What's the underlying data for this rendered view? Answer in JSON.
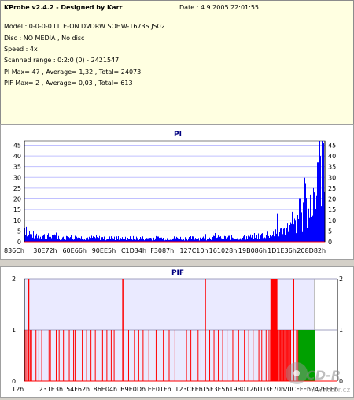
{
  "header": {
    "title": "KProbe v2.4.2 - Designed by Karr",
    "date": "Date : 4.9.2005 22:01:55",
    "model": "Model : 0-0-0-0 LITE-ON DVDRW SOHW-1673S JS02",
    "disc": "Disc : NO MEDIA , No disc",
    "speed": "Speed : 4x",
    "scanned": "Scanned range : 0:2:0 (0) - 2421547",
    "pi_summary": "PI Max= 47 , Average= 1,32 , Total= 24073",
    "pif_summary": "PIF Max= 2 , Average= 0,03 , Total= 613"
  },
  "watermark": {
    "text1": "CD-R",
    "text2": "www.cdr.cz"
  },
  "colors": {
    "pi_bar": "#0000ff",
    "pif_bar": "#ff0000",
    "pif_fill": "#00a000",
    "axis_line": "#ff0000",
    "grid": "#c0c0ff",
    "title": "#000080",
    "info_bg": "#ffffe1"
  },
  "chart_data": [
    {
      "type": "bar",
      "title": "PI",
      "ylim": [
        0,
        47
      ],
      "y_ticks": [
        0,
        5,
        10,
        15,
        20,
        25,
        30,
        35,
        40,
        45
      ],
      "x_tick_labels": [
        "836Ch",
        "30E72h",
        "60E66h",
        "90EE5h",
        "C1D34h",
        "F3087h",
        "127C10h",
        "161028h",
        "19B086h",
        "1D1E36h",
        "208D82h"
      ],
      "grid": true,
      "max": 47,
      "average": 1.32,
      "total": 24073,
      "profile": [
        {
          "x": 0.0,
          "y": 6
        },
        {
          "x": 0.02,
          "y": 3
        },
        {
          "x": 0.1,
          "y": 2
        },
        {
          "x": 0.3,
          "y": 1.5
        },
        {
          "x": 0.6,
          "y": 1.5
        },
        {
          "x": 0.75,
          "y": 2
        },
        {
          "x": 0.85,
          "y": 4
        },
        {
          "x": 0.9,
          "y": 7
        },
        {
          "x": 0.94,
          "y": 12
        },
        {
          "x": 0.97,
          "y": 20
        },
        {
          "x": 1.0,
          "y": 45
        }
      ],
      "peaks": [
        {
          "x": 0.005,
          "y": 7
        },
        {
          "x": 0.84,
          "y": 13
        },
        {
          "x": 0.89,
          "y": 14
        },
        {
          "x": 0.915,
          "y": 20
        },
        {
          "x": 0.935,
          "y": 27
        },
        {
          "x": 0.96,
          "y": 25
        },
        {
          "x": 0.975,
          "y": 37
        },
        {
          "x": 0.985,
          "y": 40
        },
        {
          "x": 0.992,
          "y": 47
        }
      ]
    },
    {
      "type": "bar",
      "title": "PIF",
      "ylim": [
        0,
        2
      ],
      "y_ticks": [
        0,
        1,
        2
      ],
      "x_tick_labels": [
        "12h",
        "231E3h",
        "54F62h",
        "86E04h",
        "B9E0Dh",
        "EE01Fh",
        "123CFEh",
        "15F3F5h",
        "19B012h",
        "1D3F70h",
        "20CFFFh",
        "242FEEh"
      ],
      "grid": true,
      "max": 2,
      "average": 0.03,
      "total": 613,
      "spikes_value_2": [
        0.013,
        0.015,
        0.34,
        0.625,
        0.858,
        0.863,
        0.868,
        0.93
      ],
      "spikes_value_1": [
        0.003,
        0.008,
        0.02,
        0.025,
        0.04,
        0.05,
        0.06,
        0.085,
        0.09,
        0.11,
        0.12,
        0.135,
        0.155,
        0.17,
        0.175,
        0.2,
        0.215,
        0.23,
        0.245,
        0.27,
        0.285,
        0.3,
        0.31,
        0.36,
        0.38,
        0.395,
        0.41,
        0.43,
        0.455,
        0.48,
        0.5,
        0.52,
        0.56,
        0.575,
        0.6,
        0.61,
        0.64,
        0.655,
        0.67,
        0.685,
        0.7,
        0.72,
        0.74,
        0.76,
        0.775,
        0.79,
        0.81,
        0.82,
        0.835,
        0.845,
        0.85,
        0.875,
        0.88,
        0.885,
        0.895,
        0.905,
        0.91,
        0.915,
        0.92,
        0.94,
        0.945
      ],
      "dense_region": [
        0.85,
        0.93
      ],
      "filled_region": {
        "from": 0.945,
        "to": 1.0,
        "value": 1
      }
    }
  ]
}
